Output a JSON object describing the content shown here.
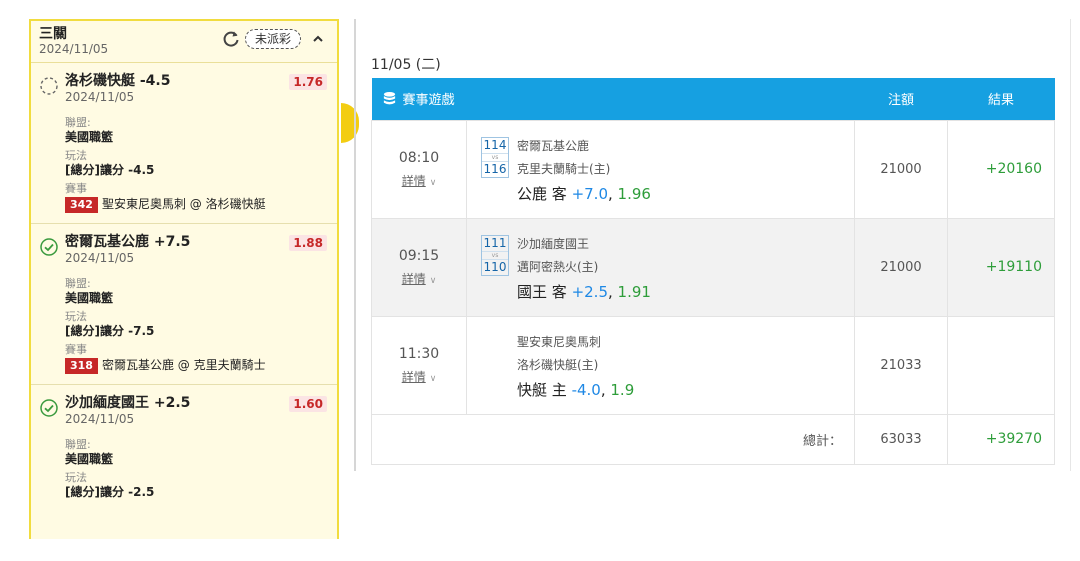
{
  "slip": {
    "title": "三關",
    "date": "2024/11/05",
    "pending_badge": "未派彩",
    "bets": [
      {
        "status": "pending",
        "title": "洛杉磯快艇 -4.5",
        "date": "2024/11/05",
        "odds": "1.76",
        "league_label": "聯盟:",
        "league": "美國職籃",
        "play_label": "玩法",
        "play": "[總分]讓分 -4.5",
        "event_label": "賽事",
        "event_id": "342",
        "event": "聖安東尼奧馬刺 @ 洛杉磯快艇"
      },
      {
        "status": "won",
        "title": "密爾瓦基公鹿 +7.5",
        "date": "2024/11/05",
        "odds": "1.88",
        "league_label": "聯盟:",
        "league": "美國職籃",
        "play_label": "玩法",
        "play": "[總分]讓分 -7.5",
        "event_label": "賽事",
        "event_id": "318",
        "event": "密爾瓦基公鹿 @ 克里夫蘭騎士"
      },
      {
        "status": "won",
        "title": "沙加緬度國王 +2.5",
        "date": "2024/11/05",
        "odds": "1.60",
        "league_label": "聯盟:",
        "league": "美國職籃",
        "play_label": "玩法",
        "play": "[總分]讓分 -2.5"
      }
    ]
  },
  "main": {
    "day_label": "11/05 (二)",
    "headers": {
      "game": "賽事遊戲",
      "amount": "注額",
      "result": "結果"
    },
    "rows": [
      {
        "time": "08:10",
        "detail": "詳情",
        "away_id": "114",
        "vs": "vs",
        "home_id": "116",
        "away": "密爾瓦基公鹿",
        "home": "克里夫蘭騎士(主)",
        "pick_team": "公鹿 客",
        "pick_line": "+7.0",
        "pick_odds": "1.96",
        "amount": "21000",
        "result": "+20160"
      },
      {
        "time": "09:15",
        "detail": "詳情",
        "away_id": "111",
        "vs": "vs",
        "home_id": "110",
        "away": "沙加緬度國王",
        "home": "邁阿密熱火(主)",
        "pick_team": "國王 客",
        "pick_line": "+2.5",
        "pick_odds": "1.91",
        "amount": "21000",
        "result": "+19110"
      },
      {
        "time": "11:30",
        "detail": "詳情",
        "away": "聖安東尼奧馬刺",
        "home": "洛杉磯快艇(主)",
        "pick_team": "快艇 主",
        "pick_line": "-4.0",
        "pick_odds": "1.9",
        "amount": "21033",
        "result": ""
      }
    ],
    "total": {
      "label": "總計：",
      "amount": "63033",
      "result": "+39270"
    }
  },
  "colors": {
    "accent": "#16a0e1",
    "panel_border": "#f1dc3f",
    "win": "#2e9d3a",
    "odds_red": "#c62828"
  },
  "icons": {
    "refresh": "refresh-icon",
    "collapse": "chevron-up-icon",
    "pending": "pending-circle-icon",
    "won": "check-circle-icon",
    "header": "database-icon"
  }
}
